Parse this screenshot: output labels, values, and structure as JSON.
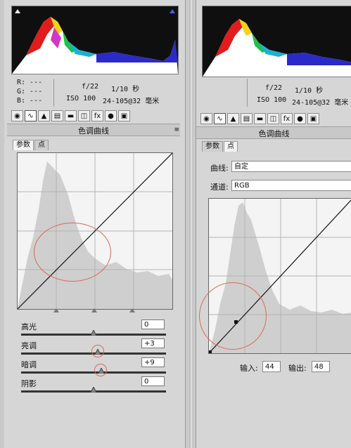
{
  "left": {
    "readout": {
      "r": "R:  ---",
      "g": "G:  ---",
      "b": "B:  ---",
      "aperture": "f/22",
      "shutter": "1/10 秒",
      "iso": "ISO 100",
      "lens": "24-105@32 毫米"
    },
    "section_title": "色调曲线",
    "tabs": [
      "参数",
      "点"
    ],
    "sliders": [
      {
        "label": "高光",
        "value": "0",
        "level": 0.0
      },
      {
        "label": "亮调",
        "value": "+3",
        "level": 0.03
      },
      {
        "label": "暗调",
        "value": "+9",
        "level": 0.09
      },
      {
        "label": "阴影",
        "value": "0",
        "level": 0.0
      }
    ]
  },
  "right": {
    "readout": {
      "aperture": "f/22",
      "shutter": "1/10 秒",
      "iso": "ISO 100",
      "lens": "24-105@32 毫米"
    },
    "section_title": "色调曲线",
    "tabs": [
      "参数",
      "点"
    ],
    "curve_label": "曲线:",
    "curve_value": "自定",
    "channel_label": "通道:",
    "channel_value": "RGB",
    "input_label": "输入:",
    "input_value": "44",
    "output_label": "输出:",
    "output_value": "48"
  },
  "toolbar_icons": [
    "basic-icon",
    "curve-icon",
    "detail-icon",
    "hsl-icon",
    "split-tone-icon",
    "lens-icon",
    "fx-icon",
    "camera-icon",
    "presets-icon"
  ],
  "colors": {
    "panel": "#d6d6d6",
    "highlight": "#d66a5e",
    "hist_gray": "#cfcfcf"
  }
}
